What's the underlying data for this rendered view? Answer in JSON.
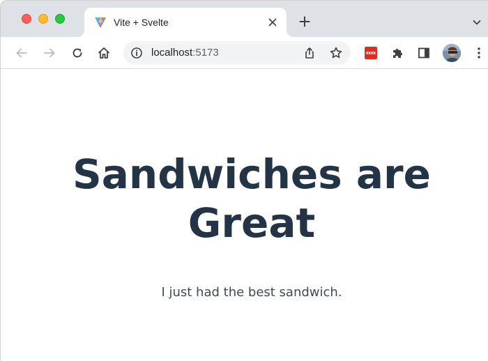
{
  "tab": {
    "title": "Vite + Svelte"
  },
  "omnibox": {
    "host": "localhost",
    "port": ":5173"
  },
  "page": {
    "headline_line1": "Sandwiches are",
    "headline_line2": "Great",
    "subtext": "I just had the best sandwich."
  },
  "colors": {
    "tabstrip": "#dee1e6",
    "heading": "#233447",
    "extension_red": "#d93025"
  },
  "icons": {
    "window_controls": [
      "close-dot",
      "minimize-dot",
      "maximize-dot"
    ],
    "tab": [
      "vite-favicon",
      "close-icon"
    ],
    "toolbar": [
      "back-arrow-icon",
      "forward-arrow-icon",
      "reload-icon",
      "home-icon",
      "info-icon",
      "share-icon",
      "star-icon",
      "extension-icon",
      "puzzle-icon",
      "side-panel-icon",
      "avatar",
      "more-vert-icon"
    ]
  }
}
